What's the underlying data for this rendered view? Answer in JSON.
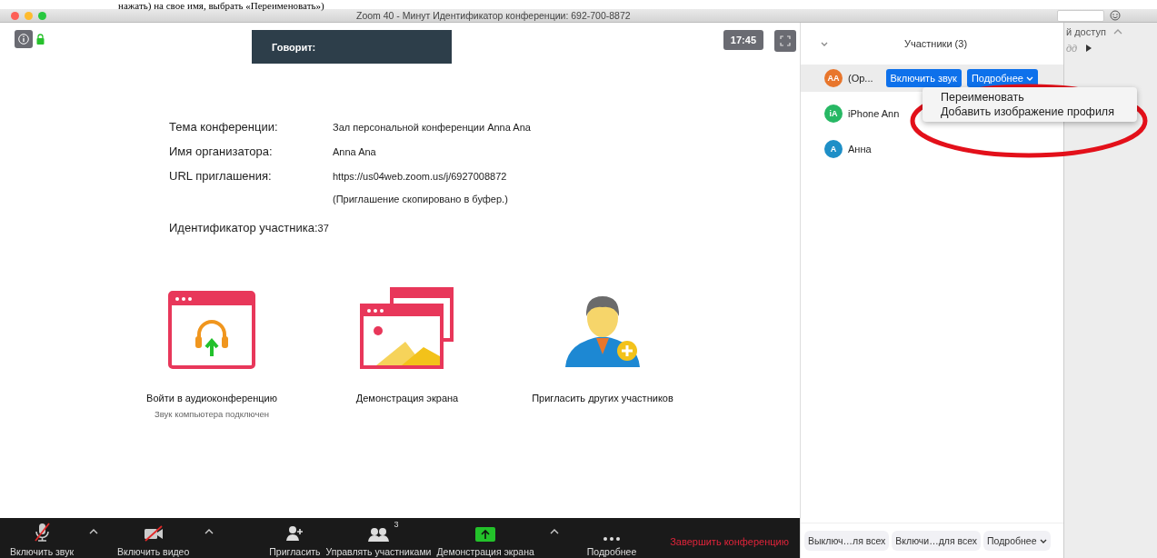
{
  "caption": "нажать) на свое имя, выбрать «Переименовать»)",
  "window": {
    "title": "Zoom  40 - Минут  Идентификатор конференции: 692-700-8872"
  },
  "meeting": {
    "speaker_label": "Говорит:",
    "clock": "17:45",
    "info": [
      {
        "label": "Тема конференции:",
        "value": "Зал персональной конференции Anna Ana"
      },
      {
        "label": "Имя организатора:",
        "value": "Anna Ana"
      },
      {
        "label": "URL приглашения:",
        "value": "https://us04web.zoom.us/j/6927008872",
        "note": "(Приглашение скопировано в буфер.)"
      }
    ],
    "participant_id": {
      "label": "Идентификатор участника:",
      "value": "37"
    },
    "actions": [
      {
        "kind": "audio",
        "label": "Войти в аудиоконференцию",
        "sub": "Звук компьютера подключен"
      },
      {
        "kind": "share",
        "label": "Демонстрация экрана"
      },
      {
        "kind": "invite",
        "label": "Пригласить других участников"
      }
    ]
  },
  "toolbar": {
    "items": [
      {
        "kind": "mic",
        "label": "Включить звук",
        "caret": true
      },
      {
        "kind": "video",
        "label": "Включить видео",
        "caret": true
      },
      {
        "kind": "invite",
        "label": "Пригласить",
        "caret": false
      },
      {
        "kind": "participants",
        "label": "Управлять участниками",
        "badge": "3",
        "caret": false
      },
      {
        "kind": "share",
        "label": "Демонстрация экрана",
        "caret": true
      },
      {
        "kind": "more",
        "label": "Подробнее",
        "caret": false
      }
    ],
    "end": "Завершить конференцию"
  },
  "participants": {
    "title": "Участники (3)",
    "rows": [
      {
        "initials": "AA",
        "name": "(Ор...",
        "color": "#e8762c",
        "selected": true,
        "buttons": [
          "Включить звук",
          "Подробнее"
        ]
      },
      {
        "initials": "iA",
        "name": "iPhone Ann",
        "color": "#27b864",
        "selected": false
      },
      {
        "initials": "A",
        "name": "Анна",
        "color": "#1e8fc7",
        "selected": false
      }
    ],
    "menu": [
      "Переименовать",
      "Добавить изображение профиля"
    ],
    "footer": [
      "Выключ…ля всех",
      "Включи…для всех",
      "Подробнее"
    ]
  },
  "background_window": {
    "texts": [
      "й доступ",
      "дд"
    ]
  }
}
